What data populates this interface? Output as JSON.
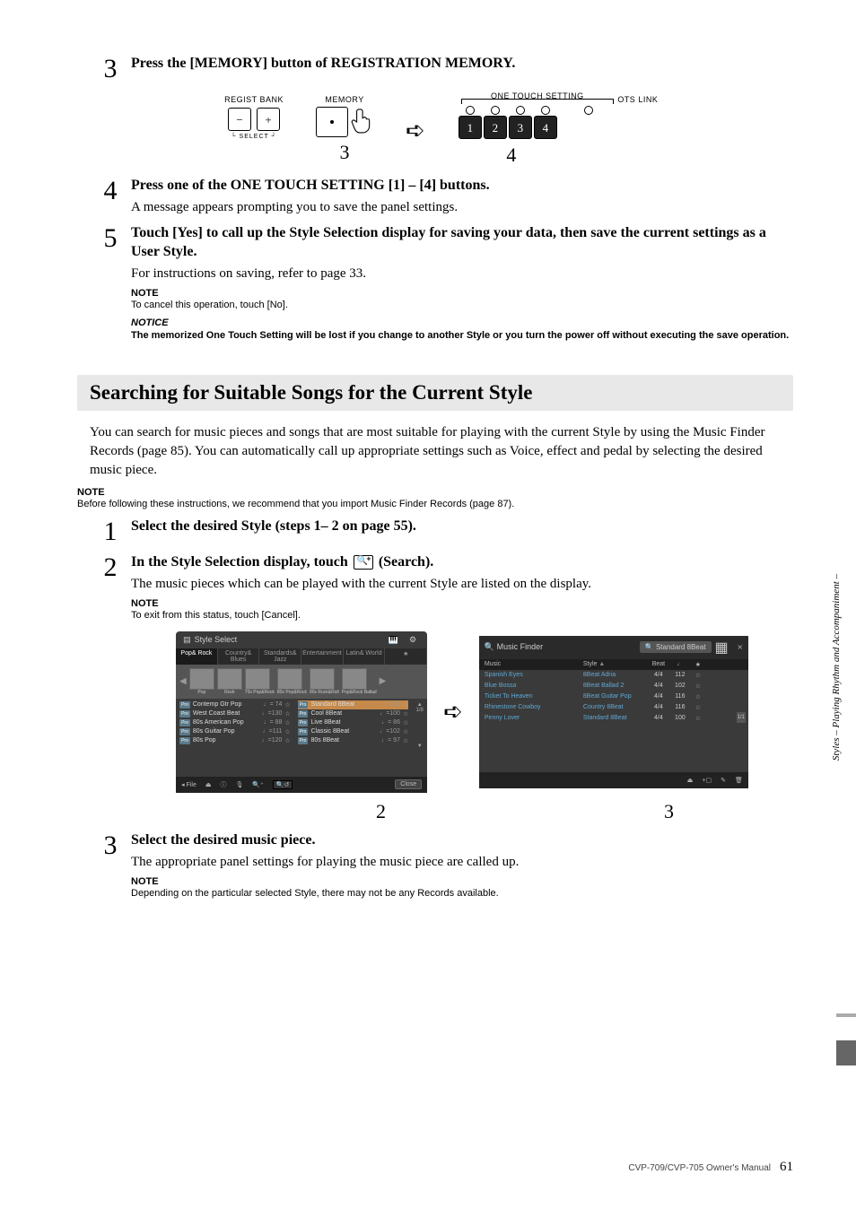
{
  "side_label": "Styles – Playing Rhythm and Accompaniment –",
  "step3": {
    "num": "3",
    "title": "Press the [MEMORY] button of REGISTRATION MEMORY."
  },
  "diagram": {
    "regist_bank": "REGIST BANK",
    "minus": "−",
    "plus": "+",
    "select": "SELECT",
    "memory": "MEMORY",
    "ots_title": "ONE TOUCH SETTING",
    "ots_link": "OTS LINK",
    "b1": "1",
    "b2": "2",
    "b3": "3",
    "b4": "4",
    "callout3": "3",
    "callout4": "4"
  },
  "step4": {
    "num": "4",
    "title": "Press one of the ONE TOUCH SETTING [1] – [4] buttons.",
    "text": "A message appears prompting you to save the panel settings."
  },
  "step5": {
    "num": "5",
    "title": "Touch [Yes] to call up the Style Selection display for saving your data, then save the current settings as a User Style.",
    "text": "For instructions on saving, refer to page 33.",
    "note_label": "NOTE",
    "note_text": "To cancel this operation, touch [No].",
    "notice_label": "NOTICE",
    "notice_text": "The memorized One Touch Setting will be lost if you change to another Style or you turn the power off without executing the save operation."
  },
  "section_title": "Searching for Suitable Songs for the Current Style",
  "intro": "You can search for music pieces and songs that are most suitable for playing with the current Style by using the Music Finder Records (page 85). You can automatically call up appropriate settings such as Voice, effect and pedal by selecting the desired music piece.",
  "intro_note_label": "NOTE",
  "intro_note_text": "Before following these instructions, we recommend that you import Music Finder Records (page 87).",
  "s2_step1": {
    "num": "1",
    "title": "Select the desired Style (steps 1– 2 on page 55)."
  },
  "s2_step2": {
    "num": "2",
    "title_a": "In the Style Selection display, touch ",
    "title_b": " (Search).",
    "text": "The music pieces which can be played with the current Style are listed on the display.",
    "note_label": "NOTE",
    "note_text": "To exit from this status, touch [Cancel]."
  },
  "style_select": {
    "title": "Style Select",
    "tabs": [
      "Pop& Rock",
      "Country& Blues",
      "Standards& Jazz",
      "Entertainment",
      "Latin& World",
      "★",
      ""
    ],
    "thumbs": [
      "Pop",
      "Rock",
      "70s Pop&Rock",
      "80s Pop&Rock",
      "80s Rock&Roll",
      "Pop&Rock Ballad"
    ],
    "rows_left": [
      {
        "name": "Contemp Gtr Pop",
        "tempo": "♩= 74"
      },
      {
        "name": "West Coast Beat",
        "tempo": "♩=130"
      },
      {
        "name": "80s American Pop",
        "tempo": "♩= 88"
      },
      {
        "name": "80s Guitar Pop",
        "tempo": "♩=111"
      },
      {
        "name": "80s Pop",
        "tempo": "♩=120"
      }
    ],
    "rows_right": [
      {
        "name": "Standard 8Beat",
        "tempo": "♩=100",
        "sel": true
      },
      {
        "name": "Cool 8Beat",
        "tempo": "♩=100"
      },
      {
        "name": "Live 8Beat",
        "tempo": "♩= 86"
      },
      {
        "name": "Classic 8Beat",
        "tempo": "♩=102"
      },
      {
        "name": "80s 8Beat",
        "tempo": "♩= 97"
      }
    ],
    "page": "1/8",
    "footer": {
      "file": "File",
      "close": "Close"
    }
  },
  "music_finder": {
    "title": "Music Finder",
    "search_value": "Standard 8Beat",
    "head": {
      "c1": "Music",
      "c2": "Style",
      "c3": "Beat",
      "c4": "♩",
      "c5": "★"
    },
    "rows": [
      {
        "m": "Spanish Eyes",
        "s": "8Beat Adria",
        "b": "4/4",
        "t": "112"
      },
      {
        "m": "Blue Bossa",
        "s": "8Beat Ballad 2",
        "b": "4/4",
        "t": "102"
      },
      {
        "m": "Ticket To Heaven",
        "s": "8Beat Guitar Pop",
        "b": "4/4",
        "t": "116"
      },
      {
        "m": "Rhinestone Cowboy",
        "s": "Country 8Beat",
        "b": "4/4",
        "t": "116"
      },
      {
        "m": "Penny Lover",
        "s": "Standard 8Beat",
        "b": "4/4",
        "t": "100"
      }
    ],
    "side": "1/1"
  },
  "fig2_callout2": "2",
  "fig2_callout3": "3",
  "s2_step3": {
    "num": "3",
    "title": "Select the desired music piece.",
    "text": "The appropriate panel settings for playing the music piece are called up.",
    "note_label": "NOTE",
    "note_text": "Depending on the particular selected Style, there may not be any Records available."
  },
  "footer_manual": "CVP-709/CVP-705 Owner's Manual",
  "footer_page": "61"
}
